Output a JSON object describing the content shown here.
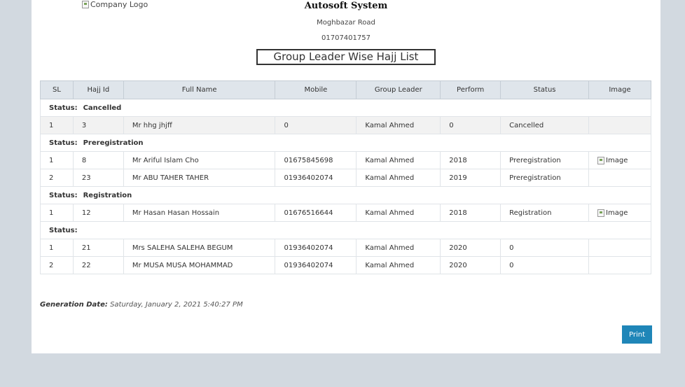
{
  "header": {
    "logo_alt": "Company Logo",
    "company_name": "Autosoft System",
    "address": "Moghbazar Road",
    "phone": "01707401757",
    "report_title": "Group Leader Wise Hajj List"
  },
  "table": {
    "columns": [
      "SL",
      "Hajj Id",
      "Full Name",
      "Mobile",
      "Group Leader",
      "Perform",
      "Status",
      "Image"
    ],
    "status_prefix": "Status:",
    "groups": [
      {
        "status": "Cancelled",
        "rows": [
          {
            "sl": "1",
            "hajj_id": "3",
            "full_name": "Mr hhg jhjff",
            "mobile": "0",
            "group_leader": "Kamal Ahmed",
            "perform": "0",
            "status": "Cancelled",
            "image": ""
          }
        ]
      },
      {
        "status": "Preregistration",
        "rows": [
          {
            "sl": "1",
            "hajj_id": "8",
            "full_name": "Mr Ariful Islam Cho",
            "mobile": "01675845698",
            "group_leader": "Kamal Ahmed",
            "perform": "2018",
            "status": "Preregistration",
            "image": "Image"
          },
          {
            "sl": "2",
            "hajj_id": "23",
            "full_name": "Mr ABU TAHER TAHER",
            "mobile": "01936402074",
            "group_leader": "Kamal Ahmed",
            "perform": "2019",
            "status": "Preregistration",
            "image": ""
          }
        ]
      },
      {
        "status": "Registration",
        "rows": [
          {
            "sl": "1",
            "hajj_id": "12",
            "full_name": "Mr Hasan Hasan Hossain",
            "mobile": "01676516644",
            "group_leader": "Kamal Ahmed",
            "perform": "2018",
            "status": "Registration",
            "image": "Image"
          }
        ]
      },
      {
        "status": "",
        "rows": [
          {
            "sl": "1",
            "hajj_id": "21",
            "full_name": "Mrs SALEHA SALEHA BEGUM",
            "mobile": "01936402074",
            "group_leader": "Kamal Ahmed",
            "perform": "2020",
            "status": "0",
            "image": ""
          },
          {
            "sl": "2",
            "hajj_id": "22",
            "full_name": "Mr MUSA MUSA MOHAMMAD",
            "mobile": "01936402074",
            "group_leader": "Kamal Ahmed",
            "perform": "2020",
            "status": "0",
            "image": ""
          }
        ]
      }
    ]
  },
  "footer": {
    "generation_label": "Generation Date:",
    "generation_value": "Saturday, January 2, 2021 5:40:27 PM",
    "print_label": "Print"
  }
}
